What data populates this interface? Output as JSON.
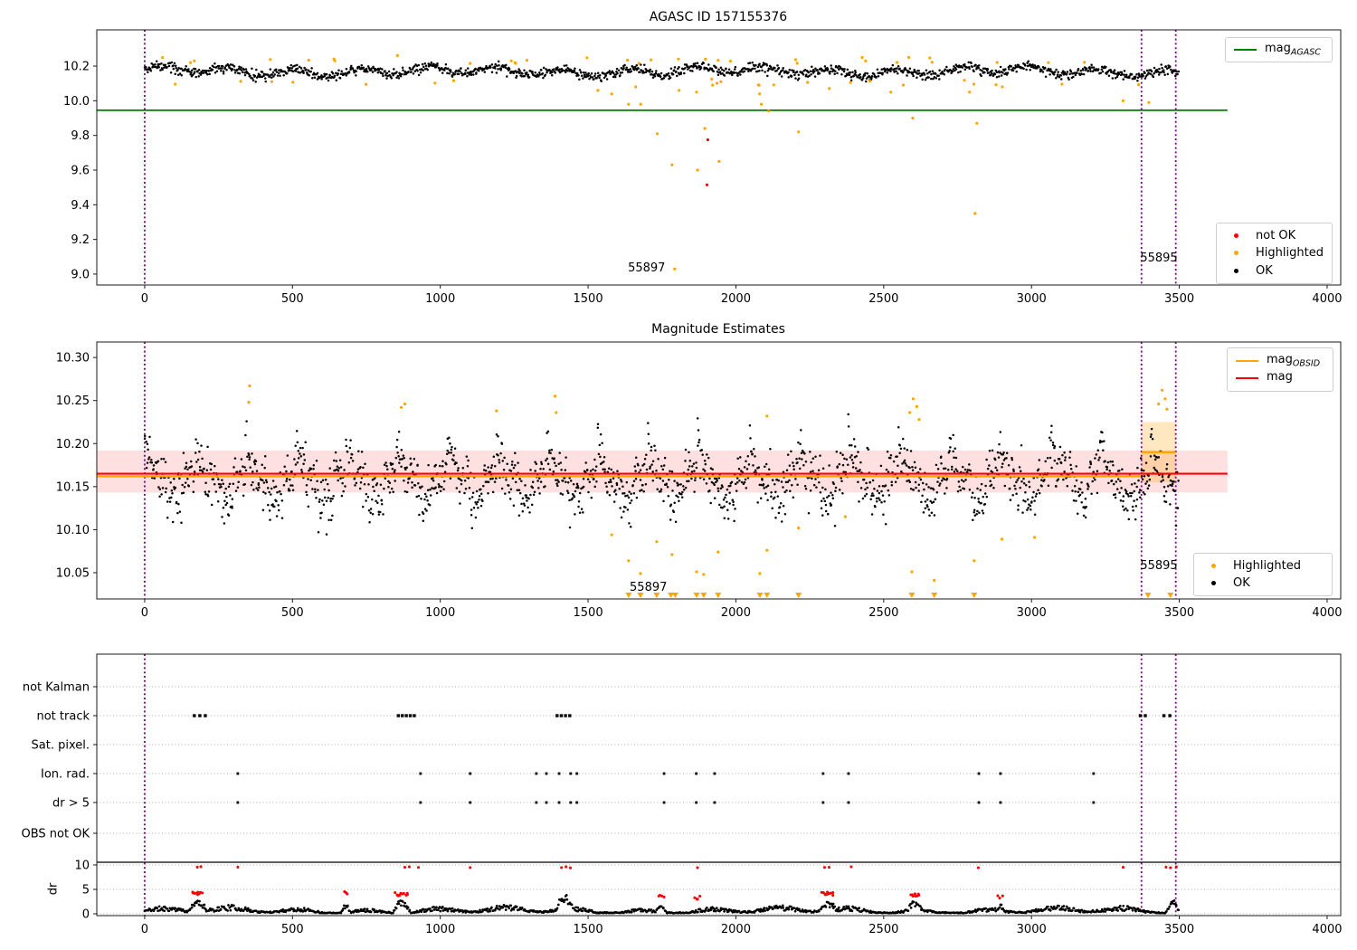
{
  "page": {
    "background": "#ffffff"
  },
  "colors": {
    "ok": "#000000",
    "highlighted": "#ffa500",
    "not_ok": "#ff0000",
    "mag_agasc_line": "#008000",
    "mag_line": "#ff0000",
    "mag_obsid_line": "#ffa500",
    "vline": "#800080",
    "band_red": "rgba(255,0,0,0.12)",
    "band_orange": "rgba(255,165,0,0.25)",
    "grid": "#aaaaaa",
    "spine": "#1a1a1a"
  },
  "chart_data": [
    {
      "type": "scatter",
      "title": "AGASC ID 157155376",
      "xlim": [
        -162,
        4046
      ],
      "ylim": [
        8.937,
        10.409
      ],
      "xticks": [
        0,
        500,
        1000,
        1500,
        2000,
        2500,
        3000,
        3500,
        4000
      ],
      "xticklabels": [
        "0",
        "500",
        "1000",
        "1500",
        "2000",
        "2500",
        "3000",
        "3500",
        "4000"
      ],
      "yticks": [
        9.0,
        9.2,
        9.4,
        9.6,
        9.8,
        10.0,
        10.2
      ],
      "yticklabels": [
        "9.0",
        "9.2",
        "9.4",
        "9.6",
        "9.8",
        "10.0",
        "10.2"
      ],
      "legend_line": {
        "main": "mag",
        "sub": "AGASC",
        "color": "#008000"
      },
      "legend_points": [
        {
          "label": "not OK",
          "color": "#ff0000"
        },
        {
          "label": "Highlighted",
          "color": "#ffa500"
        },
        {
          "label": "OK",
          "color": "#000000"
        }
      ],
      "hline": {
        "y": 9.945,
        "x0": -162,
        "x1": 3663,
        "color": "#008000"
      },
      "vlines": {
        "xs": [
          0,
          3372,
          3488
        ],
        "color": "#800080"
      },
      "annotations": [
        {
          "text": "55897",
          "x": 1698,
          "y": 9.012
        },
        {
          "text": "55895",
          "x": 3431,
          "y": 9.07
        }
      ],
      "ok_points": {
        "n": 1500,
        "x_max": 3500,
        "base": 10.17,
        "noise": 0.026,
        "seed": 42
      },
      "highlighted_band": {
        "n": 46,
        "seed": 7
      },
      "highlighted_outliers": [
        [
          155,
          10.22
        ],
        [
          168,
          10.23
        ],
        [
          430,
          10.11
        ],
        [
          640,
          10.24
        ],
        [
          855,
          10.26
        ],
        [
          1240,
          10.23
        ],
        [
          1533,
          10.06
        ],
        [
          1580,
          10.04
        ],
        [
          1637,
          9.98
        ],
        [
          1661,
          10.08
        ],
        [
          1678,
          9.98
        ],
        [
          1734,
          9.81
        ],
        [
          1784,
          9.63
        ],
        [
          1793,
          9.03
        ],
        [
          1808,
          10.06
        ],
        [
          1867,
          10.05
        ],
        [
          1870,
          9.6
        ],
        [
          1895,
          9.84
        ],
        [
          1897,
          10.24
        ],
        [
          1943,
          9.65
        ],
        [
          2080,
          10.04
        ],
        [
          2086,
          9.98
        ],
        [
          2111,
          9.94
        ],
        [
          2212,
          9.82
        ],
        [
          2316,
          10.07
        ],
        [
          2427,
          10.25
        ],
        [
          2524,
          10.05
        ],
        [
          2585,
          10.25
        ],
        [
          2598,
          9.9
        ],
        [
          2790,
          10.05
        ],
        [
          2809,
          9.35
        ],
        [
          2815,
          9.87
        ],
        [
          2901,
          10.08
        ],
        [
          3310,
          10.0
        ],
        [
          3397,
          9.99
        ]
      ],
      "not_ok_points": [
        [
          1905,
          9.775
        ],
        [
          1902,
          9.515
        ]
      ]
    },
    {
      "type": "scatter",
      "title": "Magnitude Estimates",
      "xlim": [
        -162,
        4046
      ],
      "ylim": [
        10.0195,
        10.318
      ],
      "xticks": [
        0,
        500,
        1000,
        1500,
        2000,
        2500,
        3000,
        3500,
        4000
      ],
      "xticklabels": [
        "0",
        "500",
        "1000",
        "1500",
        "2000",
        "2500",
        "3000",
        "3500",
        "4000"
      ],
      "yticks": [
        10.05,
        10.1,
        10.15,
        10.2,
        10.25,
        10.3
      ],
      "yticklabels": [
        "10.05",
        "10.10",
        "10.15",
        "10.20",
        "10.25",
        "10.30"
      ],
      "legend_lines": [
        {
          "main": "mag",
          "sub": "OBSID",
          "color": "#ffa500"
        },
        {
          "main": "mag",
          "sub": "",
          "color": "#ff0000"
        }
      ],
      "legend_points": [
        {
          "label": "Highlighted",
          "color": "#ffa500"
        },
        {
          "label": "OK",
          "color": "#000000"
        }
      ],
      "mag_line": {
        "y": 10.165,
        "x0": -162,
        "x1": 3663,
        "color": "#ff0000"
      },
      "mag_band": {
        "y0": 10.143,
        "y1": 10.192,
        "x0": -162,
        "x1": 3663
      },
      "obsid_segments": [
        {
          "x0": -162,
          "x1": 3370,
          "y": 10.162
        },
        {
          "x0": 3372,
          "x1": 3488,
          "y": 10.19
        }
      ],
      "obsid_band": {
        "x0": 3372,
        "x1": 3488,
        "y0": 10.155,
        "y1": 10.225
      },
      "vlines": {
        "xs": [
          0,
          3372,
          3488
        ],
        "color": "#800080"
      },
      "annotations": [
        {
          "text": "55897",
          "x": 1704,
          "y": 10.028
        },
        {
          "text": "55895",
          "x": 3431,
          "y": 10.053
        }
      ],
      "ok_points": {
        "n": 1750,
        "x_max": 3500,
        "base": 10.165,
        "noise": 0.03,
        "seed": 5
      },
      "highlighted_high": [
        [
          352,
          10.248
        ],
        [
          355,
          10.267
        ],
        [
          868,
          10.242
        ],
        [
          880,
          10.246
        ],
        [
          1190,
          10.238
        ],
        [
          1388,
          10.255
        ],
        [
          1392,
          10.236
        ],
        [
          2105,
          10.232
        ],
        [
          2588,
          10.236
        ],
        [
          2600,
          10.252
        ],
        [
          2612,
          10.243
        ],
        [
          2620,
          10.228
        ],
        [
          3430,
          10.246
        ],
        [
          3442,
          10.262
        ],
        [
          3452,
          10.252
        ],
        [
          3458,
          10.24
        ]
      ],
      "highlighted_low": [
        [
          1580,
          10.094
        ],
        [
          1637,
          10.064
        ],
        [
          1677,
          10.049
        ],
        [
          1732,
          10.086
        ],
        [
          1784,
          10.071
        ],
        [
          1867,
          10.051
        ],
        [
          1891,
          10.048
        ],
        [
          1940,
          10.074
        ],
        [
          2081,
          10.049
        ],
        [
          2105,
          10.076
        ],
        [
          2212,
          10.102
        ],
        [
          2370,
          10.115
        ],
        [
          2595,
          10.051
        ],
        [
          2671,
          10.041
        ],
        [
          2806,
          10.064
        ],
        [
          2900,
          10.089
        ],
        [
          3010,
          10.091
        ]
      ],
      "clipped_triangles_x": [
        1637,
        1677,
        1732,
        1780,
        1795,
        1867,
        1891,
        1940,
        2081,
        2105,
        2212,
        2595,
        2671,
        2806,
        3394,
        3470
      ]
    },
    {
      "type": "scatter",
      "categories": [
        "not Kalman",
        "not track",
        "Sat. pixel.",
        "Ion. rad.",
        "dr > 5",
        "OBS not OK"
      ],
      "dr_label": "dr",
      "dr_ticks": [
        0,
        5,
        10
      ],
      "dr_ticklabels": [
        "0",
        "5",
        "10"
      ],
      "xticks": [
        0,
        500,
        1000,
        1500,
        2000,
        2500,
        3000,
        3500,
        4000
      ],
      "xticklabels": [
        "0",
        "500",
        "1000",
        "1500",
        "2000",
        "2500",
        "3000",
        "3500",
        "4000"
      ],
      "threshold_line": {
        "dr": 10,
        "color": "#000000"
      },
      "vlines": {
        "xs": [
          0,
          3372,
          3488
        ],
        "color": "#800080"
      },
      "not_track_runs": [
        [
          168,
          205
        ],
        [
          858,
          912
        ],
        [
          1395,
          1438
        ],
        [
          3368,
          3385
        ],
        [
          3448,
          3468
        ]
      ],
      "ion_rad_x": [
        315,
        933,
        1101,
        1325,
        1359,
        1402,
        1441,
        1462,
        1757,
        1866,
        1928,
        2295,
        2381,
        2822,
        2895,
        3210
      ],
      "dr_gt5_x": [
        315,
        933,
        1101,
        1325,
        1359,
        1402,
        1441,
        1462,
        1757,
        1866,
        1928,
        2295,
        2381,
        2822,
        2895,
        3210
      ],
      "dr_red_clusters": [
        [
          160,
          195,
          4.2
        ],
        [
          675,
          684,
          4.3
        ],
        [
          848,
          890,
          4.0
        ],
        [
          1740,
          1756,
          3.6
        ],
        [
          1862,
          1876,
          3.3
        ],
        [
          2290,
          2330,
          4.1
        ],
        [
          2590,
          2620,
          3.9
        ],
        [
          2888,
          2900,
          3.4
        ]
      ],
      "dr_red_clipped_x": [
        178,
        190,
        315,
        880,
        895,
        926,
        1101,
        1410,
        1425,
        1440,
        1870,
        2300,
        2315,
        2390,
        2820,
        3310,
        3455,
        3470,
        3490
      ],
      "dr_black": {
        "n": 1150,
        "seed": 11,
        "bumps": [
          [
            150,
            210,
            2.6
          ],
          [
            665,
            695,
            1.8
          ],
          [
            840,
            900,
            2.9
          ],
          [
            1390,
            1450,
            3.1
          ],
          [
            1730,
            1765,
            1.4
          ],
          [
            2280,
            2340,
            1.9
          ],
          [
            2580,
            2630,
            2.1
          ],
          [
            2880,
            2910,
            1.1
          ],
          [
            3455,
            3500,
            2.3
          ]
        ]
      }
    }
  ]
}
